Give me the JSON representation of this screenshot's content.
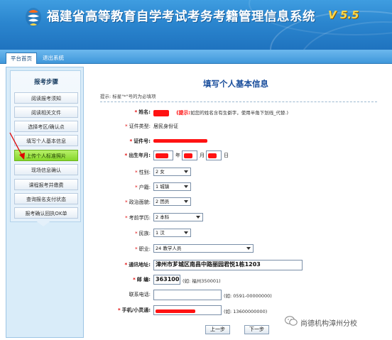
{
  "header": {
    "title": "福建省高等教育自学考试考务考籍管理信息系统",
    "version": "V 5.5"
  },
  "nav": {
    "tabs": [
      "平台首页",
      "退出系统"
    ]
  },
  "sidebar": {
    "title": "报考步骤",
    "steps": [
      {
        "label": "阅读报考须知",
        "active": false
      },
      {
        "label": "阅读相关文件",
        "active": false
      },
      {
        "label": "选择考区/确认点",
        "active": false
      },
      {
        "label": "填写个人基本信息",
        "active": false
      },
      {
        "label": "上传个人标准照片",
        "active": true
      },
      {
        "label": "现场信息确认",
        "active": false
      },
      {
        "label": "课程报考并缴费",
        "active": false
      },
      {
        "label": "查询报名支付状态",
        "active": false
      },
      {
        "label": "报考确认回执OK单",
        "active": false
      }
    ]
  },
  "form": {
    "title": "填写个人基本信息",
    "hint": "提示: 标星\"*\"号的为必填项",
    "name_label": "姓名:",
    "name_tip_prefix": "(提示:",
    "name_tip": "如您的姓名含有生僻字，使用半角下划线_代替.)",
    "id_type_label": "证件类型:",
    "id_type_value": "居民身份证",
    "id_number_label": "证件号:",
    "birth_label": "出生年月:",
    "birth_year_unit": "年",
    "birth_month_unit": "月",
    "birth_day_unit": "日",
    "gender_label": "性别:",
    "gender_value": "2 女",
    "household_label": "户籍:",
    "household_value": "1 城镇",
    "political_label": "政治面貌:",
    "political_value": "2 团员",
    "education_label": "考前学历:",
    "education_value": "2 本科",
    "ethnic_label": "民族:",
    "ethnic_value": "1 汉",
    "occupation_label": "职业:",
    "occupation_value": "24 教学人员",
    "address_label": "通讯地址:",
    "address_value": "漳州市芗城区南昌中路丽园君悦1栋1203",
    "postal_label": "邮 编:",
    "postal_value": "363100",
    "postal_hint": "(如: 福州350001)",
    "phone_label": "联系电话:",
    "phone_hint": "(如: 0591-00000000)",
    "mobile_label": "手机/小灵通:",
    "mobile_hint": "(如: 13600000000)",
    "prev_button": "上一步",
    "next_button": "下一步"
  },
  "watermark": {
    "text": "尚德机构漳州分校"
  },
  "colors": {
    "header_blue": "#2b86cf",
    "title_blue": "#1a4e9c",
    "required_red": "#e00000",
    "active_step_green": "#86d72b",
    "version_yellow": "#ffd84a"
  }
}
